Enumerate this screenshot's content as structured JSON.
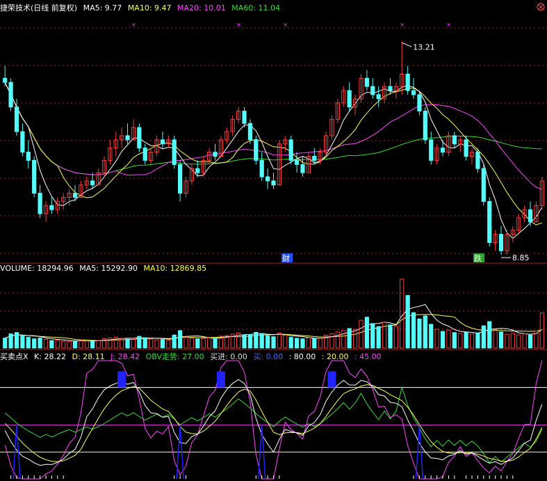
{
  "colors": {
    "bg": "#000000",
    "up": "#ff3c3c",
    "down": "#54fcfc",
    "ma5": "#ffffff",
    "ma10": "#ffff55",
    "ma20": "#ff44ff",
    "ma60": "#33dd33",
    "grid": "#aa2222",
    "marker": "#ff44ff",
    "kdj_k": "#ffffff",
    "kdj_d": "#ffff55",
    "kdj_j": "#ff44ff",
    "obv": "#33dd33",
    "buy": "#2222ff",
    "ref": "#ffffff"
  },
  "price_header": {
    "title": "捷荣技术(日线 前复权)",
    "ma5": "MA5: 9.77",
    "ma10": "MA10: 9.47",
    "ma20": "MA20: 10.01",
    "ma60": "MA60: 11.04"
  },
  "volume_header": {
    "title": "VOLUME: 18294.96",
    "ma5": "MA5: 15292.90",
    "ma10": "MA10: 12869.85"
  },
  "ind_header": {
    "title": "买卖点X",
    "k": "K: 28.22",
    "d": "D: 28.11",
    "j": "J: 28.42",
    "obv": "OBV走势: 27.00",
    "buy_in": "买进: 0.00",
    "buy": "买: 0.00",
    "v80": ": 80.00",
    "v20": ": 20.00",
    "v45": ": 45.00"
  },
  "annotations": {
    "high": "13.21",
    "low": "8.85",
    "cai": "财",
    "die": "跌",
    "close_icon": "close-icon"
  },
  "chart_data": {
    "type": "candlestick",
    "price_range": [
      7.9,
      13.9
    ],
    "ohlc": [
      [
        12.3,
        12.6,
        12.1,
        12.2
      ],
      [
        12.2,
        12.3,
        11.5,
        11.6
      ],
      [
        11.6,
        11.8,
        10.9,
        11.0
      ],
      [
        11.0,
        11.2,
        10.4,
        10.5
      ],
      [
        10.5,
        10.8,
        10.1,
        10.3
      ],
      [
        10.3,
        10.4,
        9.4,
        9.5
      ],
      [
        9.5,
        9.7,
        8.9,
        9.0
      ],
      [
        9.0,
        9.3,
        8.8,
        9.2
      ],
      [
        9.2,
        9.4,
        9.0,
        9.1
      ],
      [
        9.1,
        9.4,
        9.0,
        9.3
      ],
      [
        9.3,
        9.5,
        9.1,
        9.4
      ],
      [
        9.4,
        9.6,
        9.2,
        9.5
      ],
      [
        9.5,
        9.7,
        9.3,
        9.4
      ],
      [
        9.4,
        9.8,
        9.4,
        9.7
      ],
      [
        9.7,
        9.9,
        9.6,
        9.8
      ],
      [
        9.8,
        10.0,
        9.6,
        9.7
      ],
      [
        9.7,
        10.1,
        9.7,
        10.0
      ],
      [
        10.0,
        10.4,
        9.9,
        10.3
      ],
      [
        10.3,
        10.8,
        10.2,
        10.6
      ],
      [
        10.6,
        11.0,
        10.4,
        10.8
      ],
      [
        10.8,
        11.1,
        10.6,
        10.9
      ],
      [
        10.9,
        11.2,
        10.7,
        10.8
      ],
      [
        10.8,
        11.3,
        10.8,
        11.1
      ],
      [
        11.1,
        11.2,
        10.5,
        10.6
      ],
      [
        10.6,
        10.7,
        10.2,
        10.3
      ],
      [
        10.3,
        10.6,
        10.2,
        10.5
      ],
      [
        10.5,
        10.9,
        10.4,
        10.8
      ],
      [
        10.8,
        11.0,
        10.6,
        10.7
      ],
      [
        10.7,
        10.9,
        10.6,
        10.8
      ],
      [
        10.8,
        10.9,
        10.1,
        10.2
      ],
      [
        10.2,
        10.3,
        9.3,
        9.5
      ],
      [
        9.5,
        9.9,
        9.4,
        9.8
      ],
      [
        9.8,
        10.2,
        9.7,
        10.1
      ],
      [
        10.1,
        10.3,
        9.9,
        10.0
      ],
      [
        10.0,
        10.4,
        9.9,
        10.3
      ],
      [
        10.3,
        10.6,
        10.2,
        10.5
      ],
      [
        10.5,
        10.7,
        10.3,
        10.4
      ],
      [
        10.4,
        10.9,
        10.4,
        10.8
      ],
      [
        10.8,
        11.1,
        10.7,
        11.0
      ],
      [
        11.0,
        11.4,
        10.9,
        11.3
      ],
      [
        11.3,
        11.6,
        11.2,
        11.5
      ],
      [
        11.5,
        11.6,
        11.1,
        11.2
      ],
      [
        11.2,
        11.3,
        10.7,
        10.8
      ],
      [
        10.8,
        10.9,
        10.2,
        10.3
      ],
      [
        10.3,
        10.5,
        9.8,
        9.9
      ],
      [
        9.9,
        10.1,
        9.6,
        9.8
      ],
      [
        9.8,
        10.0,
        9.6,
        9.7
      ],
      [
        9.7,
        10.8,
        9.7,
        10.7
      ],
      [
        10.7,
        10.9,
        10.5,
        10.8
      ],
      [
        10.8,
        10.9,
        10.2,
        10.3
      ],
      [
        10.3,
        10.5,
        10.0,
        10.2
      ],
      [
        10.2,
        10.4,
        9.9,
        10.0
      ],
      [
        10.0,
        10.5,
        10.0,
        10.4
      ],
      [
        10.4,
        10.6,
        10.2,
        10.3
      ],
      [
        10.3,
        10.6,
        10.2,
        10.5
      ],
      [
        10.5,
        11.0,
        10.4,
        10.9
      ],
      [
        10.9,
        11.4,
        10.8,
        11.3
      ],
      [
        11.3,
        11.8,
        11.2,
        11.7
      ],
      [
        11.7,
        12.1,
        11.6,
        12.0
      ],
      [
        12.0,
        12.2,
        11.5,
        11.6
      ],
      [
        11.6,
        11.9,
        11.4,
        11.8
      ],
      [
        11.8,
        12.4,
        11.7,
        12.3
      ],
      [
        12.3,
        12.5,
        12.0,
        12.1
      ],
      [
        12.1,
        12.3,
        11.8,
        11.9
      ],
      [
        11.9,
        12.1,
        11.6,
        11.8
      ],
      [
        11.8,
        12.2,
        11.7,
        12.1
      ],
      [
        12.1,
        12.3,
        11.9,
        12.0
      ],
      [
        12.0,
        12.2,
        11.8,
        12.1
      ],
      [
        12.1,
        13.2,
        11.9,
        12.4
      ],
      [
        12.4,
        12.6,
        11.9,
        12.0
      ],
      [
        12.0,
        12.3,
        11.8,
        11.9
      ],
      [
        11.9,
        12.0,
        11.4,
        11.5
      ],
      [
        11.5,
        11.6,
        10.7,
        10.8
      ],
      [
        10.8,
        11.0,
        10.2,
        10.3
      ],
      [
        10.3,
        10.7,
        10.2,
        10.6
      ],
      [
        10.6,
        10.8,
        10.4,
        10.5
      ],
      [
        10.5,
        11.0,
        10.4,
        10.9
      ],
      [
        10.9,
        11.0,
        10.6,
        10.7
      ],
      [
        10.7,
        10.9,
        10.5,
        10.8
      ],
      [
        10.8,
        10.9,
        10.3,
        10.4
      ],
      [
        10.4,
        10.6,
        10.2,
        10.5
      ],
      [
        10.5,
        10.6,
        10.0,
        10.1
      ],
      [
        10.1,
        10.2,
        9.2,
        9.3
      ],
      [
        9.3,
        9.4,
        8.2,
        8.3
      ],
      [
        8.3,
        8.6,
        8.1,
        8.5
      ],
      [
        8.5,
        8.7,
        8.0,
        8.1
      ],
      [
        8.1,
        8.6,
        8.0,
        8.5
      ],
      [
        8.5,
        8.7,
        8.3,
        8.6
      ],
      [
        8.6,
        9.0,
        8.5,
        8.9
      ],
      [
        8.9,
        9.2,
        8.8,
        9.1
      ],
      [
        9.1,
        9.3,
        8.7,
        8.8
      ],
      [
        8.8,
        9.3,
        8.8,
        9.2
      ],
      [
        9.2,
        9.9,
        9.1,
        9.8
      ]
    ],
    "volume": [
      5200,
      7400,
      8100,
      6300,
      5600,
      4800,
      5200,
      4600,
      3900,
      4200,
      3600,
      3400,
      3800,
      4100,
      3700,
      3500,
      4000,
      4900,
      5300,
      5700,
      5100,
      4600,
      5000,
      6100,
      5400,
      4700,
      4300,
      4500,
      4200,
      6800,
      9100,
      5800,
      5200,
      4800,
      5100,
      5400,
      4900,
      6200,
      6600,
      7300,
      7800,
      6900,
      7100,
      8200,
      7600,
      6400,
      5900,
      7800,
      6700,
      5600,
      5100,
      4800,
      5300,
      4900,
      5200,
      6800,
      7500,
      8400,
      9100,
      10200,
      9800,
      14500,
      16100,
      12800,
      11200,
      13400,
      12100,
      11600,
      36000,
      27500,
      18500,
      15200,
      16800,
      12400,
      9800,
      8700,
      9400,
      8100,
      7600,
      8300,
      7400,
      7800,
      11600,
      13800,
      9600,
      8400,
      7200,
      7700,
      6900,
      7400,
      6800,
      8900,
      18295
    ]
  }
}
